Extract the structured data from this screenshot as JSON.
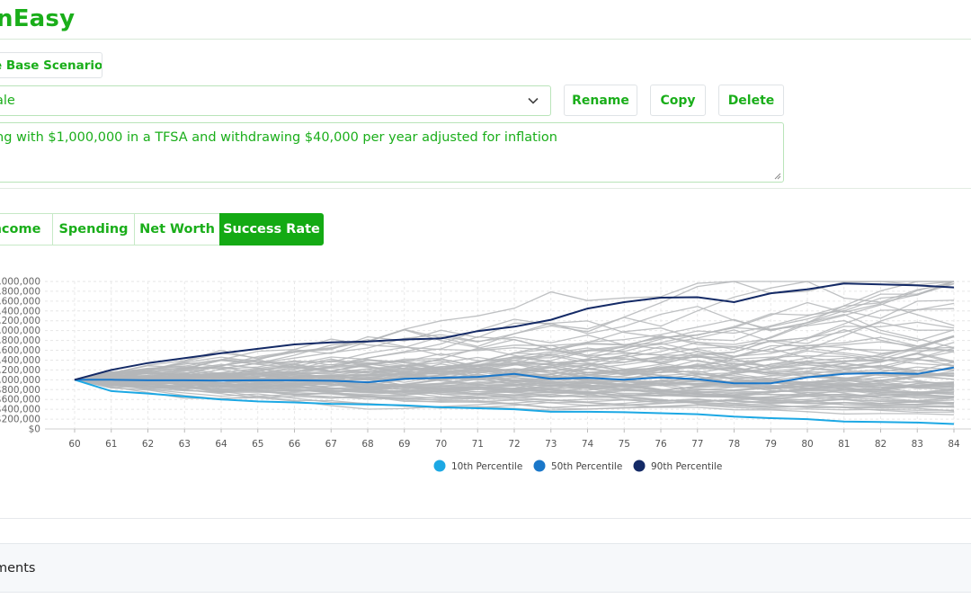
{
  "app": {
    "logo": "nEasy"
  },
  "scenario": {
    "base_button": "e Base Scenario",
    "selected": "ale",
    "rename": "Rename",
    "copy": "Copy",
    "delete": "Delete",
    "description": "ng with $1,000,000 in a TFSA and withdrawing $40,000 per year adjusted for inflation"
  },
  "tabs": [
    "ncome",
    "Spending",
    "Net Worth",
    "Success Rate"
  ],
  "active_tab": "Success Rate",
  "colors": {
    "accent": "#1aae1a",
    "p10": "#1ca8e4",
    "p50": "#1a77c9",
    "p90": "#142a66",
    "sim": "#b4b6b9"
  },
  "chart_data": {
    "type": "line",
    "x": [
      60,
      61,
      62,
      63,
      64,
      65,
      66,
      67,
      68,
      69,
      70,
      71,
      72,
      73,
      74,
      75,
      76,
      77,
      78,
      79,
      80,
      81,
      82,
      83,
      84
    ],
    "y_tick_labels": [
      "$0",
      "$200,000",
      "$400,000",
      "$600,000",
      "$800,000",
      "$1,000,000",
      "$1,200,000",
      "$1,400,000",
      "$1,600,000",
      "$1,800,000",
      "$2,000,000",
      "$2,200,000",
      "$2,400,000",
      "$2,600,000",
      "$2,800,000",
      "$3,000,000"
    ],
    "ylim": [
      0,
      3000000
    ],
    "grid": true,
    "legend_position": "bottom",
    "series": [
      {
        "name": "10th Percentile",
        "values": [
          1000000,
          770000,
          720000,
          660000,
          600000,
          560000,
          540000,
          510000,
          500000,
          480000,
          440000,
          420000,
          400000,
          350000,
          350000,
          340000,
          320000,
          300000,
          250000,
          220000,
          200000,
          150000,
          140000,
          130000,
          100000
        ]
      },
      {
        "name": "50th Percentile",
        "values": [
          1000000,
          1000000,
          990000,
          990000,
          985000,
          990000,
          990000,
          980000,
          950000,
          1020000,
          1040000,
          1060000,
          1120000,
          1020000,
          1040000,
          1000000,
          1050000,
          1010000,
          930000,
          930000,
          1050000,
          1120000,
          1140000,
          1120000,
          1250000
        ]
      },
      {
        "name": "90th Percentile",
        "values": [
          1000000,
          1200000,
          1340000,
          1440000,
          1540000,
          1630000,
          1720000,
          1760000,
          1780000,
          1820000,
          1840000,
          1990000,
          2080000,
          2220000,
          2450000,
          2580000,
          2670000,
          2680000,
          2580000,
          2760000,
          2840000,
          2960000,
          2940000,
          2920000,
          2880000
        ]
      }
    ]
  }
}
